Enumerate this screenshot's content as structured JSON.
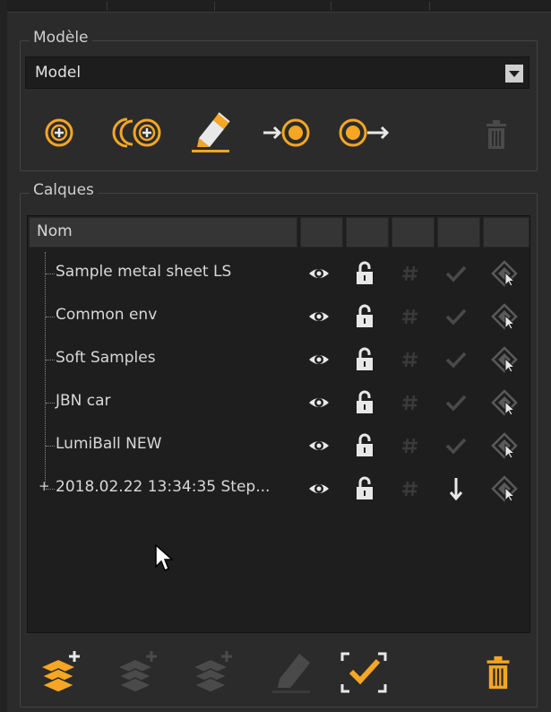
{
  "modele": {
    "title": "Modèle",
    "select_value": "Model",
    "tools": [
      {
        "icon": "add-model-icon",
        "enabled": true
      },
      {
        "icon": "add-variant-icon",
        "enabled": true
      },
      {
        "icon": "edit-model-icon",
        "enabled": true,
        "active": true
      },
      {
        "icon": "import-model-icon",
        "enabled": true
      },
      {
        "icon": "export-model-icon",
        "enabled": true
      },
      {
        "icon": "trash-icon",
        "enabled": false
      }
    ]
  },
  "calques": {
    "title": "Calques",
    "column_header": "Nom",
    "layers": [
      {
        "name": "Sample metal sheet LS",
        "expandable": false,
        "state": "check"
      },
      {
        "name": "Common env",
        "expandable": false,
        "state": "check"
      },
      {
        "name": "Soft Samples",
        "expandable": false,
        "state": "check"
      },
      {
        "name": "JBN car",
        "expandable": false,
        "state": "check"
      },
      {
        "name": "LumiBall NEW",
        "expandable": false,
        "state": "check"
      },
      {
        "name": "2018.02.22 13:34:35 Step...",
        "expandable": true,
        "expand_symbol": "+",
        "state": "arrow-down"
      }
    ],
    "bottom_tools": [
      {
        "icon": "add-layer-icon",
        "enabled": true
      },
      {
        "icon": "add-sublayer-icon",
        "enabled": false
      },
      {
        "icon": "add-layer-group-icon",
        "enabled": false
      },
      {
        "icon": "edit-layer-icon",
        "enabled": false
      },
      {
        "icon": "select-check-icon",
        "enabled": true
      },
      {
        "icon": "trash-icon",
        "enabled": true
      }
    ]
  },
  "colors": {
    "accent": "#f5a623",
    "panel_bg": "#2b2b2b",
    "list_bg": "#1e1e1e",
    "disabled": "#4a4a4a"
  }
}
